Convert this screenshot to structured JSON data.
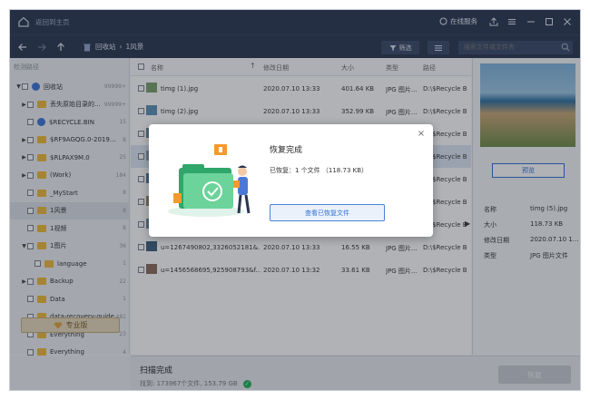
{
  "titlebar": {
    "title": "返回到主页",
    "service": "在线服务"
  },
  "nav": {
    "crumb_root": "回收站",
    "crumb_current": "1风景",
    "filter": "筛选",
    "search_placeholder": "搜索文件或文件夹"
  },
  "sidebar": {
    "header": "检测路径",
    "items": [
      {
        "label": "回收站",
        "count": "99999+",
        "arrow": "▼"
      },
      {
        "label": "丢失原始目录的...",
        "count": "99999+",
        "arrow": "▶"
      },
      {
        "label": "$RECYCLE.BIN",
        "count": "15",
        "arrow": ""
      },
      {
        "label": "$RF9AGQG.0-2019...",
        "count": "8",
        "arrow": "▶"
      },
      {
        "label": "$RLPAX9M.0",
        "count": "25",
        "arrow": "▶"
      },
      {
        "label": "(Work)",
        "count": "184",
        "arrow": "▶"
      },
      {
        "label": "_MyStart",
        "count": "8",
        "arrow": ""
      },
      {
        "label": "1风景",
        "count": "8",
        "arrow": ""
      },
      {
        "label": "1视频",
        "count": "8",
        "arrow": ""
      },
      {
        "label": "1图片",
        "count": "36",
        "arrow": "▼"
      },
      {
        "label": "language",
        "count": "1",
        "arrow": ""
      },
      {
        "label": "Backup",
        "count": "22",
        "arrow": "▶"
      },
      {
        "label": "Data",
        "count": "1",
        "arrow": ""
      },
      {
        "label": "data-recovery-guide",
        "count": "481",
        "arrow": ""
      },
      {
        "label": "Everything",
        "count": "23",
        "arrow": ""
      },
      {
        "label": "Everything",
        "count": "4",
        "arrow": ""
      }
    ],
    "pro_button": "专业版"
  },
  "table": {
    "headers": {
      "name": "名称",
      "date": "修改日期",
      "size": "大小",
      "type": "类型",
      "path": "路径"
    },
    "rows": [
      {
        "name": "timg (1).jpg",
        "date": "2020.07.10 13:33",
        "size": "401.64 KB",
        "type": "JPG 图片...",
        "path": "D:\\$Recycle B"
      },
      {
        "name": "timg (2).jpg",
        "date": "2020.07.10 13:33",
        "size": "352.99 KB",
        "type": "JPG 图片...",
        "path": "D:\\$Recycle B"
      },
      {
        "name": "",
        "date": "",
        "size": "",
        "type": "",
        "path": "D:\\$Recycle B"
      },
      {
        "name": "",
        "date": "",
        "size": "",
        "type": "",
        "path": "D:\\$Recycle B"
      },
      {
        "name": "",
        "date": "",
        "size": "",
        "type": "",
        "path": "D:\\$Recycle B"
      },
      {
        "name": "",
        "date": "",
        "size": "",
        "type": "",
        "path": "D:\\$Recycle B"
      },
      {
        "name": "",
        "date": "",
        "size": "",
        "type": "",
        "path": "D:\\$Recycle B"
      },
      {
        "name": "u=1267490802,3326052181&...",
        "date": "2020.07.10 13:33",
        "size": "16.55 KB",
        "type": "JPG 图片...",
        "path": "D:\\$Recycle B"
      },
      {
        "name": "u=1456568695,925908793&f...",
        "date": "2020.07.10 13:32",
        "size": "33.61 KB",
        "type": "JPG 图片...",
        "path": "D:\\$Recycle B"
      }
    ]
  },
  "preview": {
    "button": "预览",
    "props": [
      {
        "k": "名称",
        "v": "timg (5).jpg"
      },
      {
        "k": "大小",
        "v": "118.73 KB"
      },
      {
        "k": "修改日期",
        "v": "2020.07.10 1..."
      },
      {
        "k": "类型",
        "v": "JPG 图片文件"
      }
    ]
  },
  "footer": {
    "status": "扫描完成",
    "found": "找到: 173967个文件, 153.79 GB",
    "recover": "恢复"
  },
  "modal": {
    "title": "恢复完成",
    "message": "已恢复：1 个文件 （118.73 KB）",
    "button": "查看已恢复文件"
  },
  "colors": {
    "titlebar": "#2a3750",
    "accent": "#2f6fd8",
    "folder": "#f0b93a",
    "success": "#1fb05a"
  }
}
